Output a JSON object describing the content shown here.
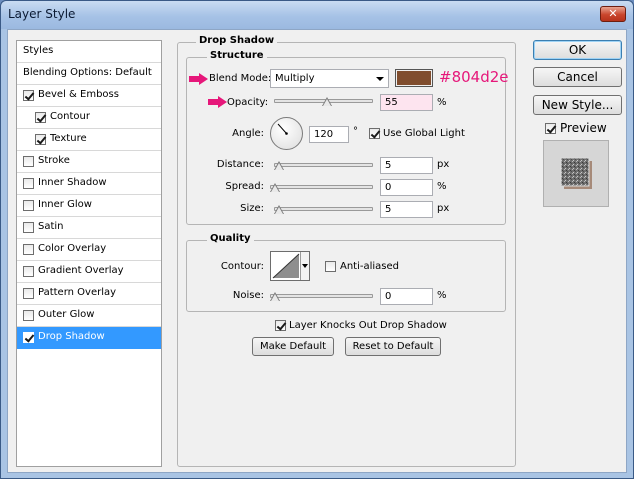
{
  "window": {
    "title": "Layer Style",
    "close_glyph": "✕"
  },
  "styles": {
    "header": "Styles",
    "blending_options": "Blending Options: Default",
    "items": [
      {
        "label": "Bevel & Emboss",
        "checked": true
      },
      {
        "label": "Contour",
        "checked": true
      },
      {
        "label": "Texture",
        "checked": true
      },
      {
        "label": "Stroke",
        "checked": false
      },
      {
        "label": "Inner Shadow",
        "checked": false
      },
      {
        "label": "Inner Glow",
        "checked": false
      },
      {
        "label": "Satin",
        "checked": false
      },
      {
        "label": "Color Overlay",
        "checked": false
      },
      {
        "label": "Gradient Overlay",
        "checked": false
      },
      {
        "label": "Pattern Overlay",
        "checked": false
      },
      {
        "label": "Outer Glow",
        "checked": false
      },
      {
        "label": "Drop Shadow",
        "checked": true,
        "selected": true
      }
    ]
  },
  "drop_shadow": {
    "title": "Drop Shadow",
    "structure": {
      "title": "Structure",
      "blend_mode_label": "Blend Mode:",
      "blend_mode_value": "Multiply",
      "color": "#804d2e",
      "color_annotation": "#804d2e",
      "opacity_label": "Opacity:",
      "opacity_value": "55",
      "opacity_unit": "%",
      "opacity_fraction": 0.55,
      "angle_label": "Angle:",
      "angle_value": "120",
      "angle_unit": "°",
      "use_global_light": "Use Global Light",
      "distance_label": "Distance:",
      "distance_value": "5",
      "distance_unit": "px",
      "spread_label": "Spread:",
      "spread_value": "0",
      "spread_unit": "%",
      "size_label": "Size:",
      "size_value": "5",
      "size_unit": "px"
    },
    "quality": {
      "title": "Quality",
      "contour_label": "Contour:",
      "anti_aliased": "Anti-aliased",
      "noise_label": "Noise:",
      "noise_value": "0",
      "noise_unit": "%"
    },
    "layer_knocks_out": "Layer Knocks Out Drop Shadow",
    "make_default": "Make Default",
    "reset_to_default": "Reset to Default"
  },
  "actions": {
    "ok": "OK",
    "cancel": "Cancel",
    "new_style": "New Style...",
    "preview": "Preview"
  },
  "colors": {
    "annotation": "#e6177a",
    "selection": "#3399ff",
    "shadow_swatch": "#804d2e"
  }
}
